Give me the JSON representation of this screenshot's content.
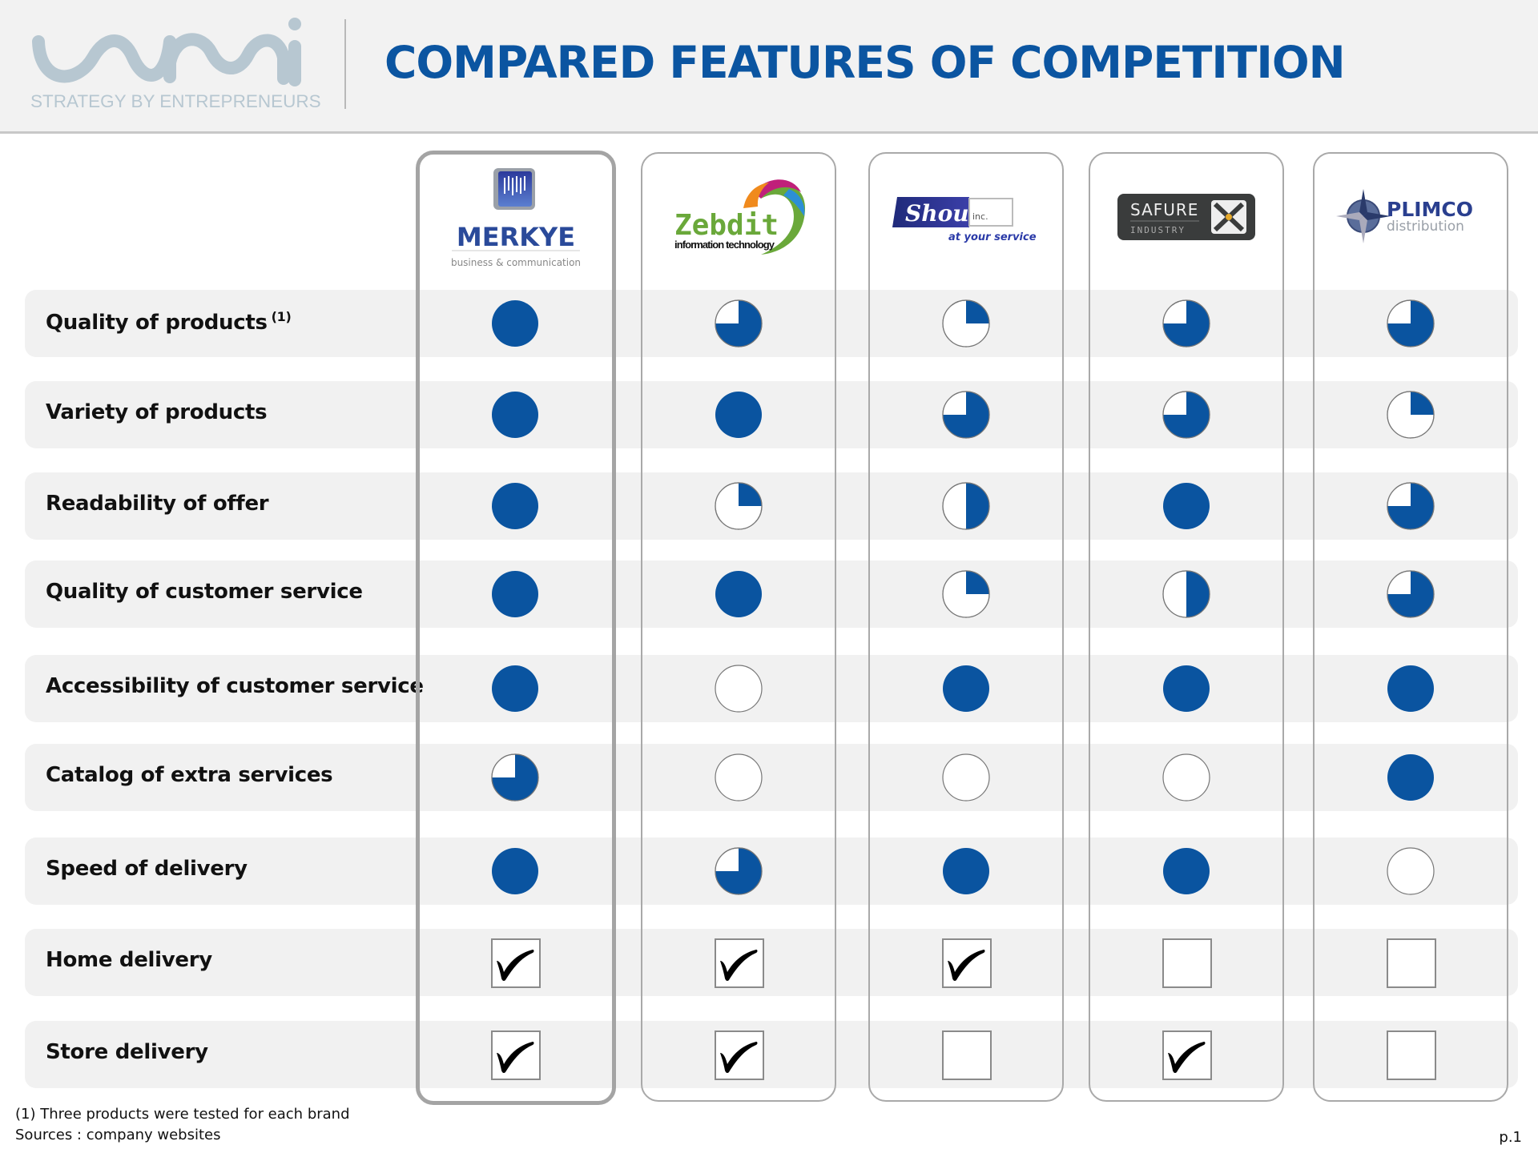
{
  "header": {
    "logo_text": "wmi",
    "logo_tagline": "STRATEGY BY ENTREPRENEURS",
    "title": "COMPARED FEATURES OF COMPETITION"
  },
  "colors": {
    "accent": "#0b55a1",
    "ball_fill": "#0a54a0",
    "row_band": "#f1f1f1",
    "header_bg": "#f2f2f2",
    "logo": "#b7c7d1"
  },
  "brands": [
    {
      "name": "MERKYE",
      "tagline": "business & communication",
      "highlighted": true
    },
    {
      "name": "Zebdit",
      "tagline": "information technology",
      "highlighted": false
    },
    {
      "name": "Shoutie",
      "suffix": "inc.",
      "tagline": "at your service",
      "highlighted": false
    },
    {
      "name": "SAFURE",
      "tagline": "INDUSTRY",
      "highlighted": false
    },
    {
      "name": "PLIMCO",
      "tagline": "distribution",
      "highlighted": false
    }
  ],
  "rating_scale": "quarters filled out of 4 (harvey ball)",
  "features": [
    {
      "label": "Quality of products",
      "note": "(1)",
      "type": "rating",
      "values": [
        4,
        3,
        1,
        3,
        3
      ]
    },
    {
      "label": "Variety of products",
      "type": "rating",
      "values": [
        4,
        4,
        3,
        3,
        1
      ]
    },
    {
      "label": "Readability of offer",
      "type": "rating",
      "values": [
        4,
        1,
        2,
        4,
        3
      ]
    },
    {
      "label": "Quality of customer service",
      "type": "rating",
      "values": [
        4,
        4,
        1,
        2,
        3
      ]
    },
    {
      "label": "Accessibility of customer service",
      "type": "rating",
      "values": [
        4,
        0,
        4,
        4,
        4
      ]
    },
    {
      "label": "Catalog of extra services",
      "type": "rating",
      "values": [
        3,
        0,
        0,
        0,
        4
      ]
    },
    {
      "label": "Speed of delivery",
      "type": "rating",
      "values": [
        4,
        3,
        4,
        4,
        0
      ]
    },
    {
      "label": "Home delivery",
      "type": "check",
      "values": [
        true,
        true,
        true,
        false,
        false
      ]
    },
    {
      "label": "Store delivery",
      "type": "check",
      "values": [
        true,
        true,
        false,
        true,
        false
      ]
    }
  ],
  "footer": {
    "note": "(1) Three products were tested for each brand",
    "sources": "Sources : company websites",
    "page": "p.1"
  }
}
